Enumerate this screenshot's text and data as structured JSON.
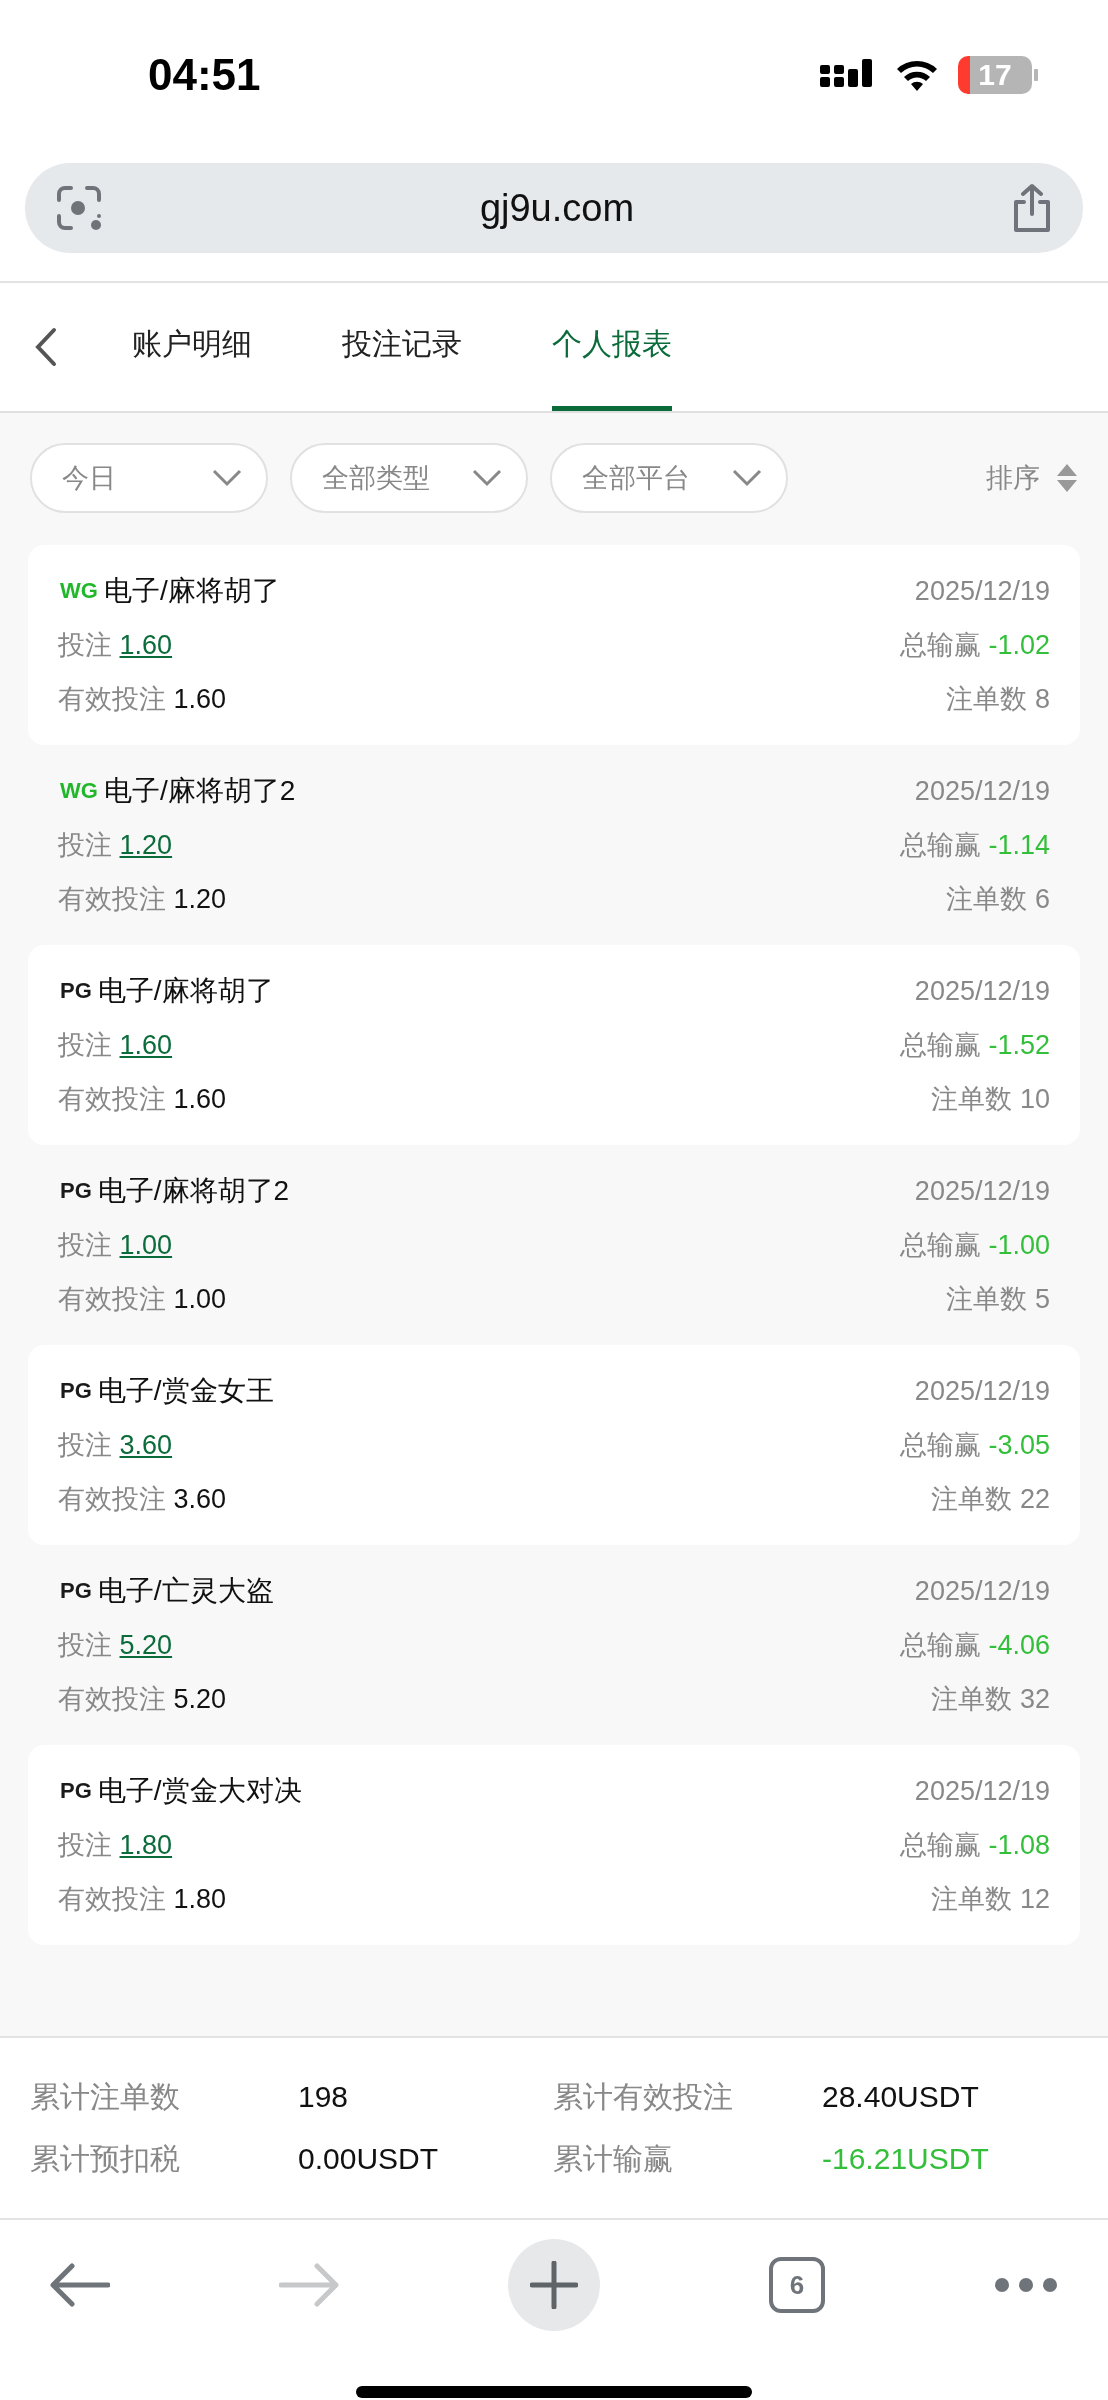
{
  "status_bar": {
    "time": "04:51",
    "battery": "17"
  },
  "address_bar": {
    "url": "gj9u.com"
  },
  "tabs": [
    {
      "label": "账户明细",
      "selected": false
    },
    {
      "label": "投注记录",
      "selected": false
    },
    {
      "label": "个人报表",
      "selected": true
    }
  ],
  "filters": [
    {
      "label": "今日"
    },
    {
      "label": "全部类型"
    },
    {
      "label": "全部平台"
    }
  ],
  "sort": {
    "label": "排序"
  },
  "records": [
    {
      "logo": {
        "text": "WG",
        "color": "#20b82a"
      },
      "title": "电子/麻将胡了",
      "date": "2025/12/19",
      "bet_label": "投注",
      "bet": "1.60",
      "win_label": "总输赢",
      "win": "-1.02",
      "valid_label": "有效投注",
      "valid": "1.60",
      "count_label": "注单数",
      "count": "8"
    },
    {
      "logo": {
        "text": "WG",
        "color": "#20b82a"
      },
      "title": "电子/麻将胡了2",
      "date": "2025/12/19",
      "bet_label": "投注",
      "bet": "1.20",
      "win_label": "总输赢",
      "win": "-1.14",
      "valid_label": "有效投注",
      "valid": "1.20",
      "count_label": "注单数",
      "count": "6"
    },
    {
      "logo": {
        "text": "PG",
        "color": "#1a1a1a"
      },
      "title": "电子/麻将胡了",
      "date": "2025/12/19",
      "bet_label": "投注",
      "bet": "1.60",
      "win_label": "总输赢",
      "win": "-1.52",
      "valid_label": "有效投注",
      "valid": "1.60",
      "count_label": "注单数",
      "count": "10"
    },
    {
      "logo": {
        "text": "PG",
        "color": "#1a1a1a"
      },
      "title": "电子/麻将胡了2",
      "date": "2025/12/19",
      "bet_label": "投注",
      "bet": "1.00",
      "win_label": "总输赢",
      "win": "-1.00",
      "valid_label": "有效投注",
      "valid": "1.00",
      "count_label": "注单数",
      "count": "5"
    },
    {
      "logo": {
        "text": "PG",
        "color": "#1a1a1a"
      },
      "title": "电子/赏金女王",
      "date": "2025/12/19",
      "bet_label": "投注",
      "bet": "3.60",
      "win_label": "总输赢",
      "win": "-3.05",
      "valid_label": "有效投注",
      "valid": "3.60",
      "count_label": "注单数",
      "count": "22"
    },
    {
      "logo": {
        "text": "PG",
        "color": "#1a1a1a"
      },
      "title": "电子/亡灵大盗",
      "date": "2025/12/19",
      "bet_label": "投注",
      "bet": "5.20",
      "win_label": "总输赢",
      "win": "-4.06",
      "valid_label": "有效投注",
      "valid": "5.20",
      "count_label": "注单数",
      "count": "32"
    },
    {
      "logo": {
        "text": "PG",
        "color": "#1a1a1a"
      },
      "title": "电子/赏金大对决",
      "date": "2025/12/19",
      "bet_label": "投注",
      "bet": "1.80",
      "win_label": "总输赢",
      "win": "-1.08",
      "valid_label": "有效投注",
      "valid": "1.80",
      "count_label": "注单数",
      "count": "12"
    }
  ],
  "summary": [
    {
      "label": "累计注单数",
      "value": "198",
      "kind": "normal"
    },
    {
      "label": "累计有效投注",
      "value": "28.40USDT",
      "kind": "normal"
    },
    {
      "label": "累计预扣税",
      "value": "0.00USDT",
      "kind": "normal"
    },
    {
      "label": "累计输赢",
      "value": "-16.21USDT",
      "kind": "loss"
    }
  ],
  "toolbar": {
    "tab_count": "6"
  }
}
